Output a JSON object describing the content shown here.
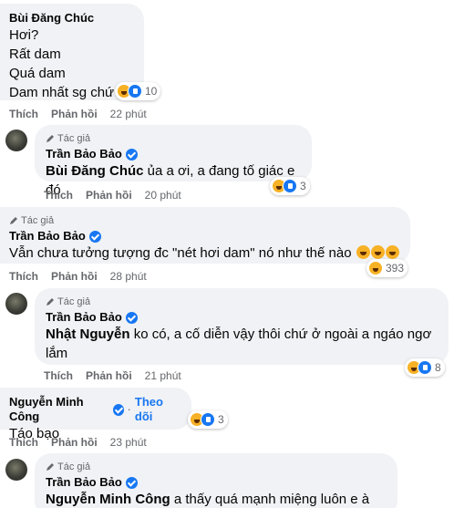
{
  "comments": [
    {
      "author": "Bùi Đăng Chúc",
      "lines": [
        "Hơi?",
        "Rất dam",
        "Quá dam",
        "Dam nhất sg chứ"
      ],
      "reaction_count": "10",
      "like_label": "Thích",
      "reply_label": "Phản hồi",
      "time": "22 phút"
    },
    {
      "tag": "Tác giả",
      "author": "Trần Bảo Bảo",
      "mention": "Bùi Đăng Chúc",
      "text": "ủa a ơi, a đang tố giác e đó",
      "reaction_count": "3",
      "like_label": "Thích",
      "reply_label": "Phản hồi",
      "time": "20 phút"
    },
    {
      "tag": "Tác giả",
      "author": "Trần Bảo Bảo",
      "text": "Vẫn chưa tưởng tượng đc \"nét hơi dam\" nó như thế nào",
      "reaction_count": "393",
      "like_label": "Thích",
      "reply_label": "Phản hồi",
      "time": "28 phút"
    },
    {
      "tag": "Tác giả",
      "author": "Trần Bảo Bảo",
      "mention": "Nhật Nguyễn",
      "text_line1": "ko có, a cố diễn vậy thôi chứ ở ngoài a ngáo ngơ",
      "text_line2": "lắm",
      "reaction_count": "8",
      "like_label": "Thích",
      "reply_label": "Phản hồi",
      "time": "21 phút"
    },
    {
      "author": "Nguyễn Minh Công",
      "follow_label": "Theo dõi",
      "text": "Táo bạo",
      "reaction_count": "3",
      "like_label": "Thích",
      "reply_label": "Phản hồi",
      "time": "23 phút"
    },
    {
      "tag": "Tác giả",
      "author": "Trần Bảo Bảo",
      "mention": "Nguyễn Minh Công",
      "text": "a thấy quá mạnh miệng luôn e à kkk"
    }
  ],
  "colors": {
    "bubble": "#f0f2f5",
    "link": "#1877f2",
    "meta": "#65676b"
  }
}
